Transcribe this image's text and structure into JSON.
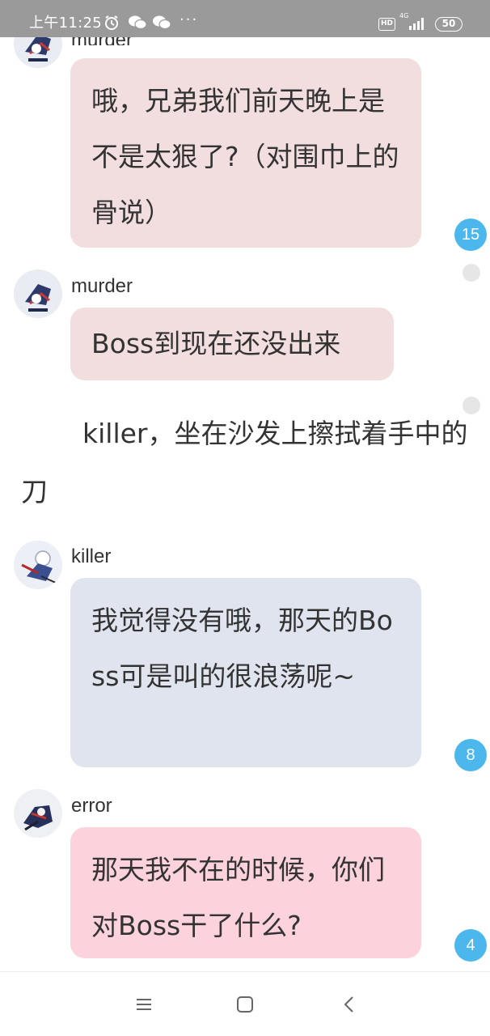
{
  "status_bar": {
    "time": "上午11:25",
    "icons": [
      "alarm-icon",
      "wechat-icon",
      "wechat-icon"
    ],
    "more": "···",
    "hd": "HD",
    "network": "4G",
    "battery": "50"
  },
  "messages": [
    {
      "sender": "murder",
      "text": "哦，兄弟我们前天晚上是不是太狠了?（对围巾上的骨说）",
      "badge": "15"
    },
    {
      "sender": "murder",
      "text": "Boss到现在还没出来"
    },
    {
      "sender": "killer",
      "text": "我觉得没有哦，那天的Boss可是叫的很浪荡呢~",
      "badge": "8"
    },
    {
      "sender": "error",
      "text": "那天我不在的时候，你们对Boss干了什么?",
      "badge": "4"
    }
  ],
  "narration": "killer，坐在沙发上擦拭着手中的刀",
  "colors": {
    "badge": "#4bb7ec",
    "bubble_murder": "#f2dede",
    "bubble_killer": "#dfe4ee",
    "bubble_error": "#fcd2dc"
  },
  "nav_bar": [
    "menu-icon",
    "home-square-icon",
    "back-chevron-icon"
  ]
}
